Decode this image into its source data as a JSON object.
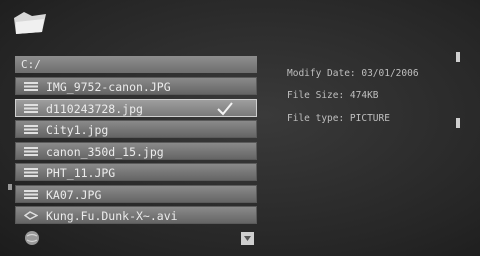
{
  "path": "C:/",
  "files": [
    {
      "name": "IMG_9752-canon.JPG",
      "icon": "image-file-icon",
      "selected": false
    },
    {
      "name": "d110243728.jpg",
      "icon": "image-file-icon",
      "selected": true
    },
    {
      "name": "City1.jpg",
      "icon": "image-file-icon",
      "selected": false
    },
    {
      "name": "canon_350d_15.jpg",
      "icon": "image-file-icon",
      "selected": false
    },
    {
      "name": "PHT_11.JPG",
      "icon": "image-file-icon",
      "selected": false
    },
    {
      "name": "KA07.JPG",
      "icon": "image-file-icon",
      "selected": false
    },
    {
      "name": "Kung.Fu.Dunk-X~.avi",
      "icon": "video-file-icon",
      "selected": false
    }
  ],
  "info": {
    "modify_date": "Modify Date: 03/01/2006",
    "file_size": "File Size: 474KB",
    "file_type": "File type: PICTURE"
  },
  "colors": {
    "background": "#2b2b2b",
    "row": "#7a7a7a",
    "selected_border": "#cfcfcf",
    "text": "#ececec"
  }
}
